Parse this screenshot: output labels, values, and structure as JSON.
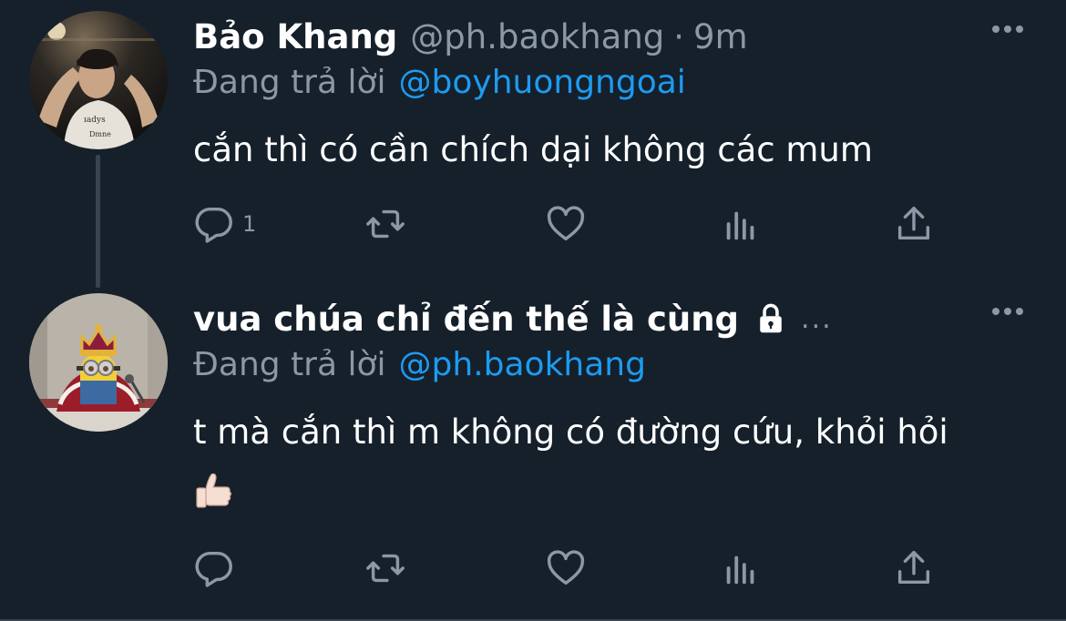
{
  "tweets": [
    {
      "name": "Bảo Khang",
      "handle": "@ph.baokhang",
      "separator": "·",
      "time": "9m",
      "reply_prefix": "Đang trả lời",
      "reply_handle": "@boyhuongngoai",
      "text": "cắn thì có cần chích dại không các mum",
      "reply_count": "1",
      "avatar_icon": "person-avatar"
    },
    {
      "name": "vua chúa chỉ đến thế là cùng",
      "protected_icon": "lock-icon",
      "truncation": "...",
      "reply_prefix": "Đang trả lời",
      "reply_handle": "@ph.baokhang",
      "text": "t mà cắn thì m không có đường cứu, khỏi hỏi",
      "emoji": "thumbs-up",
      "avatar_icon": "minion-king-avatar"
    }
  ],
  "colors": {
    "background": "#15202b",
    "secondary_text": "#8b98a5",
    "link": "#1d9bf0",
    "divider": "#38444d"
  },
  "action_icons": [
    "reply-icon",
    "retweet-icon",
    "like-icon",
    "views-icon",
    "share-icon"
  ]
}
